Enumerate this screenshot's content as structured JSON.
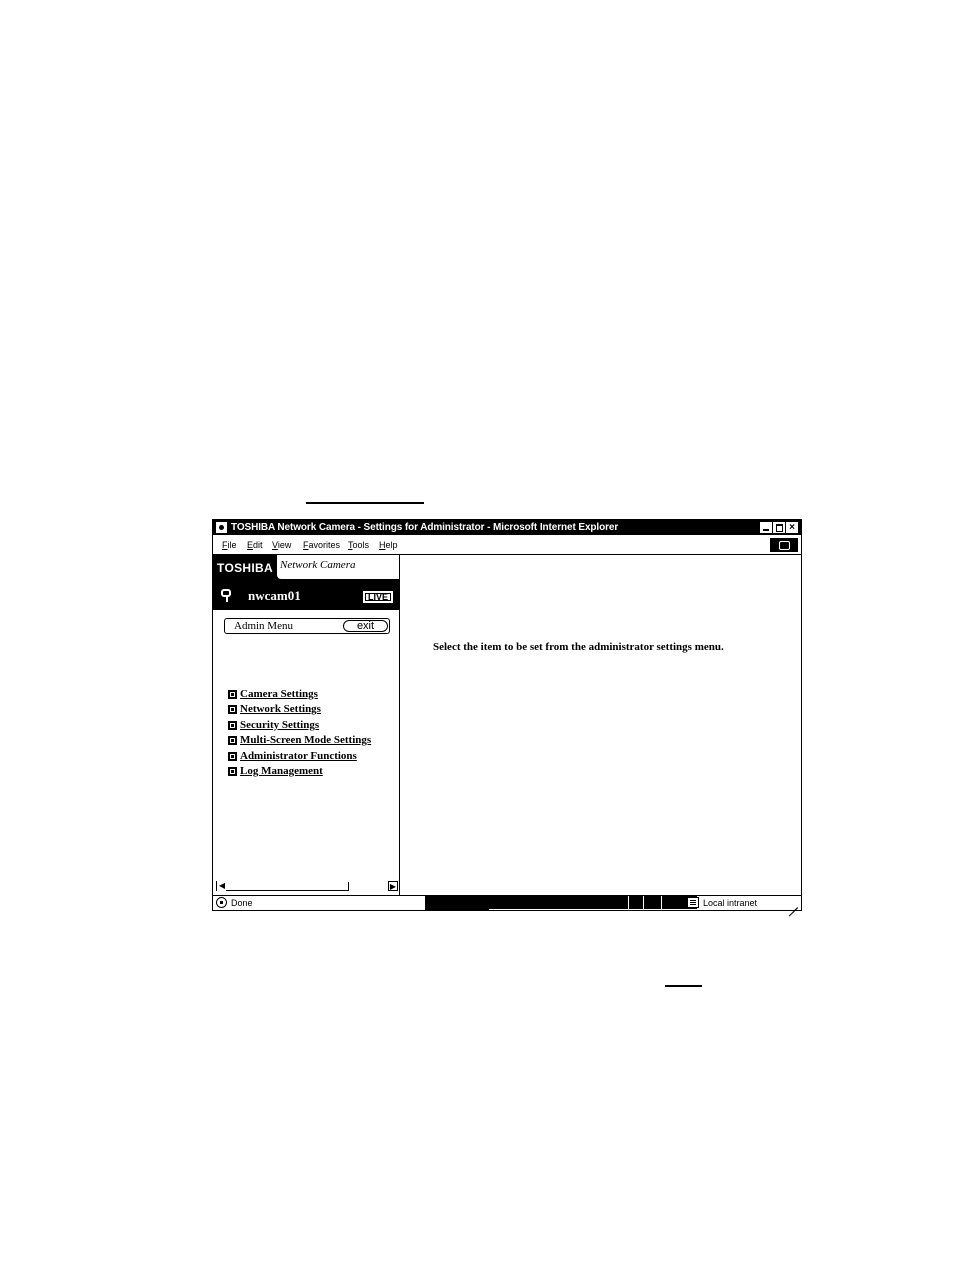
{
  "window": {
    "title": "TOSHIBA Network Camera - Settings for Administrator - Microsoft Internet Explorer",
    "buttons": {
      "minimize": "_",
      "maximize": "□",
      "close": "×"
    }
  },
  "menubar": {
    "items": [
      "File",
      "Edit",
      "View",
      "Favorites",
      "Tools",
      "Help"
    ]
  },
  "header": {
    "brand": "TOSHIBA",
    "subtitle": "Network Camera",
    "camera_name": "nwcam01",
    "live_label": "LIVE"
  },
  "admin_menu": {
    "label": "Admin Menu",
    "exit_label": "exit"
  },
  "nav": {
    "items": [
      "Camera Settings",
      "Network Settings",
      "Security Settings",
      "Multi-Screen Mode Settings",
      "Administrator Functions",
      "Log Management"
    ]
  },
  "main": {
    "instruction": "Select the item to be set from the administrator settings menu."
  },
  "statusbar": {
    "text": "Done",
    "zone": "Local intranet"
  },
  "scrollbar": {
    "left_arrow": "◀",
    "right_arrow": "▶"
  }
}
